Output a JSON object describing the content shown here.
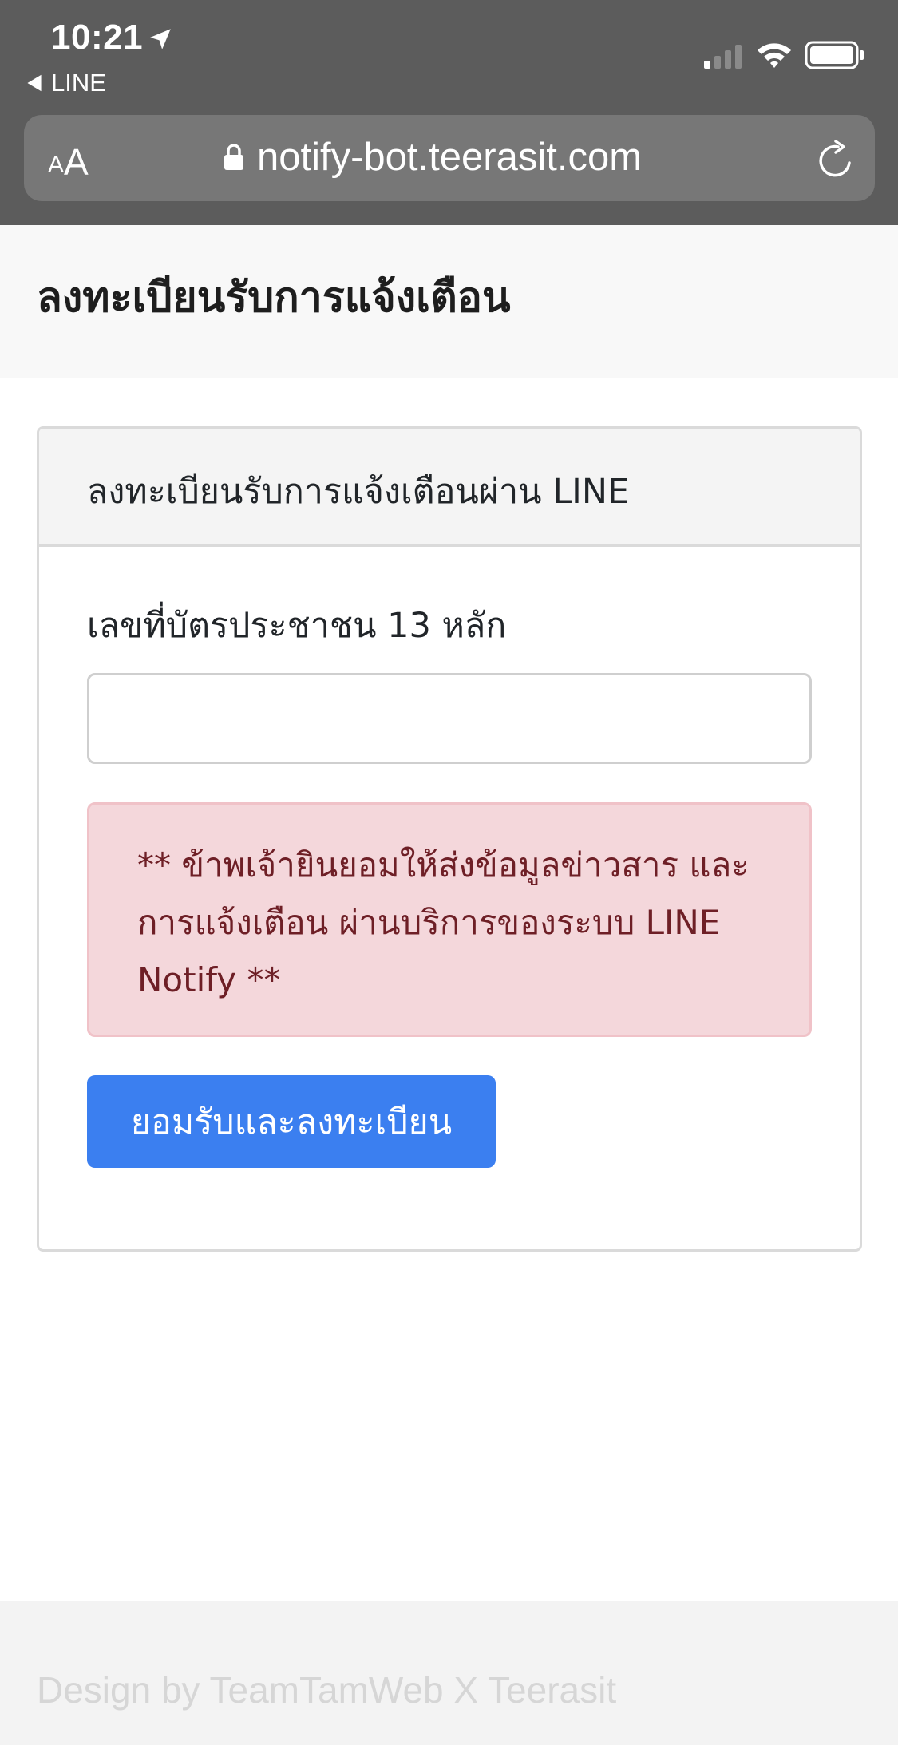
{
  "status_bar": {
    "time": "10:21",
    "back_app_label": "LINE",
    "icons": [
      "location-arrow-icon",
      "cellular-signal-icon",
      "wifi-icon",
      "battery-icon"
    ]
  },
  "browser": {
    "text_size_small": "A",
    "text_size_big": "A",
    "url": "notify-bot.teerasit.com",
    "icons": [
      "lock-icon",
      "reload-icon"
    ]
  },
  "header": {
    "title": "ลงทะเบียนรับการแจ้งเตือน"
  },
  "card": {
    "title": "ลงทะเบียนรับการแจ้งเตือนผ่าน LINE",
    "id_field": {
      "label": "เลขที่บัตรประชาชน 13 หลัก",
      "value": "",
      "placeholder": ""
    },
    "consent_text": "** ข้าพเจ้ายินยอมให้ส่งข้อมูลข่าวสาร และการแจ้งเตือน ผ่านบริการของระบบ LINE Notify **",
    "submit_label": "ยอมรับและลงทะเบียน"
  },
  "footer": {
    "text": "Design by TeamTamWeb X Teerasit"
  },
  "colors": {
    "chrome_bg": "#5c5c5c",
    "url_bar_bg": "#777777",
    "primary_button": "#3b7ff0",
    "alert_bg": "#f4d7db",
    "alert_text": "#6e1f26",
    "footer_text": "#d6d6d6"
  }
}
